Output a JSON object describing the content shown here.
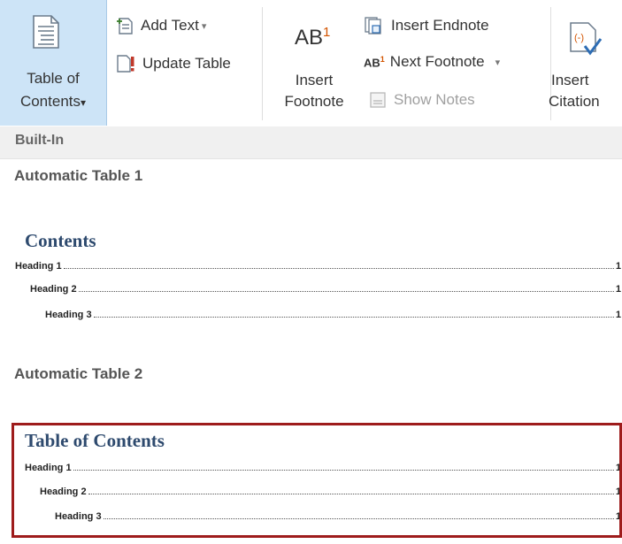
{
  "ribbon": {
    "table_of_contents": {
      "line1": "Table of",
      "line2": "Contents",
      "dropdown": "▾"
    },
    "add_text": {
      "label": "Add Text",
      "dropdown": "▾"
    },
    "update_table": {
      "label": "Update Table"
    },
    "insert_footnote": {
      "line1": "Insert",
      "line2": "Footnote",
      "icon_text": "AB",
      "superscript": "1"
    },
    "insert_endnote": {
      "label": "Insert Endnote"
    },
    "next_footnote": {
      "label": "Next Footnote",
      "dropdown": "▾",
      "icon_text": "AB",
      "superscript": "1"
    },
    "show_notes": {
      "label": "Show Notes",
      "disabled": true
    },
    "insert_citation": {
      "line1": "Insert",
      "line2": "Citation"
    }
  },
  "gallery": {
    "section_header": "Built-In",
    "items": [
      {
        "title": "Automatic Table 1",
        "heading": "Contents",
        "entries": [
          {
            "label": "Heading 1",
            "page": "1",
            "level": 1
          },
          {
            "label": "Heading 2",
            "page": "1",
            "level": 2
          },
          {
            "label": "Heading 3",
            "page": "1",
            "level": 3
          }
        ]
      },
      {
        "title": "Automatic Table 2",
        "heading": "Table of Contents",
        "entries": [
          {
            "label": "Heading 1",
            "page": "1",
            "level": 1
          },
          {
            "label": "Heading 2",
            "page": "1",
            "level": 2
          },
          {
            "label": "Heading 3",
            "page": "1",
            "level": 3
          }
        ],
        "selected": true
      }
    ]
  },
  "colors": {
    "ribbon_selected": "#cde4f7",
    "toc_heading": "#2e4a6e",
    "highlight_border": "#9e1c1c",
    "section_header_bg": "#f0f0f0"
  }
}
